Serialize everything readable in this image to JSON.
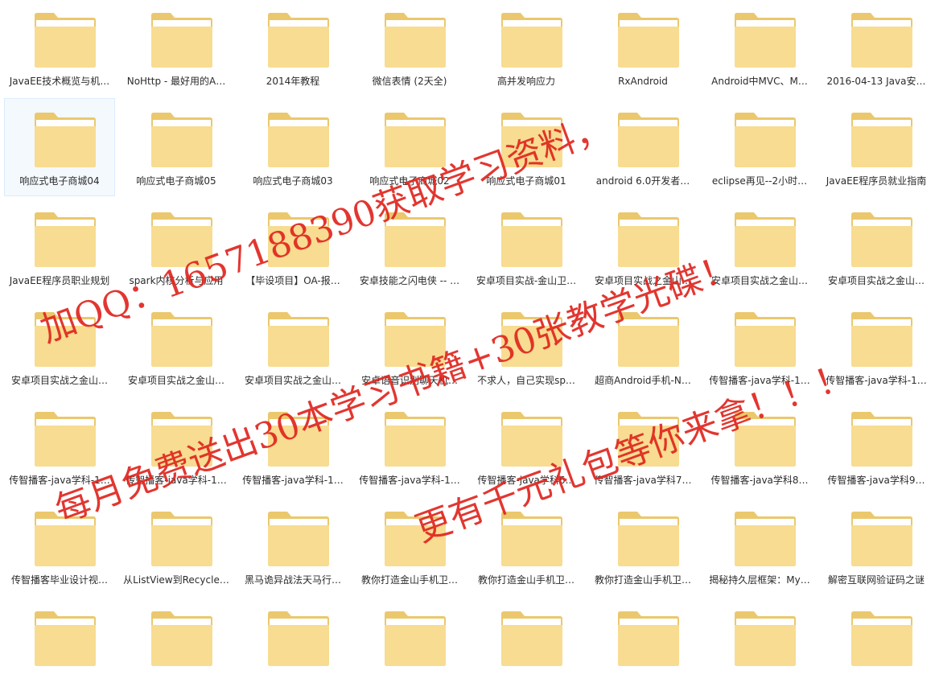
{
  "folders": [
    {
      "label": "JavaEE技术概览与机…",
      "selected": false
    },
    {
      "label": "NoHttp - 最好用的A…",
      "selected": false
    },
    {
      "label": "2014年教程",
      "selected": false
    },
    {
      "label": "微信表情 (2天全)",
      "selected": false
    },
    {
      "label": "高并发响应力",
      "selected": false
    },
    {
      "label": "RxAndroid",
      "selected": false
    },
    {
      "label": "Android中MVC、M…",
      "selected": false
    },
    {
      "label": "2016-04-13 Java安…",
      "selected": false
    },
    {
      "label": "响应式电子商城04",
      "selected": true
    },
    {
      "label": "响应式电子商城05",
      "selected": false
    },
    {
      "label": "响应式电子商城03",
      "selected": false
    },
    {
      "label": "响应式电子商城02",
      "selected": false
    },
    {
      "label": "响应式电子商城01",
      "selected": false
    },
    {
      "label": "android 6.0开发者…",
      "selected": false
    },
    {
      "label": "eclipse再见--2小时…",
      "selected": false
    },
    {
      "label": "JavaEE程序员就业指南",
      "selected": false
    },
    {
      "label": "JavaEE程序员职业规划",
      "selected": false
    },
    {
      "label": "spark内核分析与应用",
      "selected": false
    },
    {
      "label": "【毕设项目】OA-报…",
      "selected": false
    },
    {
      "label": "安卓技能之闪电侠 -- …",
      "selected": false
    },
    {
      "label": "安卓项目实战-金山卫…",
      "selected": false
    },
    {
      "label": "安卓项目实战之金山…",
      "selected": false
    },
    {
      "label": "安卓项目实战之金山…",
      "selected": false
    },
    {
      "label": "安卓项目实战之金山…",
      "selected": false
    },
    {
      "label": "安卓项目实战之金山…",
      "selected": false
    },
    {
      "label": "安卓项目实战之金山…",
      "selected": false
    },
    {
      "label": "安卓项目实战之金山…",
      "selected": false
    },
    {
      "label": "安卓语音识别聊天机…",
      "selected": false
    },
    {
      "label": "不求人，自己实现sp…",
      "selected": false
    },
    {
      "label": "超商Android手机-N…",
      "selected": false
    },
    {
      "label": "传智播客-java学科-1…",
      "selected": false
    },
    {
      "label": "传智播客-java学科-1…",
      "selected": false
    },
    {
      "label": "传智播客-java学科-1…",
      "selected": false
    },
    {
      "label": "传智播客-java学科-1…",
      "selected": false
    },
    {
      "label": "传智播客-java学科-1…",
      "selected": false
    },
    {
      "label": "传智播客-java学科-1…",
      "selected": false
    },
    {
      "label": "传智播客-java学科6…",
      "selected": false
    },
    {
      "label": "传智播客-java学科7…",
      "selected": false
    },
    {
      "label": "传智播客-java学科8…",
      "selected": false
    },
    {
      "label": "传智播客-java学科9…",
      "selected": false
    },
    {
      "label": "传智播客毕业设计视…",
      "selected": false
    },
    {
      "label": "从ListView到Recycle…",
      "selected": false
    },
    {
      "label": "黑马诡异战法天马行…",
      "selected": false
    },
    {
      "label": "教你打造金山手机卫…",
      "selected": false
    },
    {
      "label": "教你打造金山手机卫…",
      "selected": false
    },
    {
      "label": "教你打造金山手机卫…",
      "selected": false
    },
    {
      "label": "揭秘持久层框架：My…",
      "selected": false
    },
    {
      "label": "解密互联网验证码之谜",
      "selected": false
    },
    {
      "label": "",
      "selected": false
    },
    {
      "label": "",
      "selected": false
    },
    {
      "label": "",
      "selected": false
    },
    {
      "label": "",
      "selected": false
    },
    {
      "label": "",
      "selected": false
    },
    {
      "label": "",
      "selected": false
    },
    {
      "label": "",
      "selected": false
    },
    {
      "label": "",
      "selected": false
    }
  ],
  "folder_icon": "folder-icon",
  "colors": {
    "folder_back": "#ebc86d",
    "folder_front": "#f7dc91",
    "folder_paper": "#ffffff",
    "selection_bg": "#f4f9fe",
    "selection_border": "#dcecfc",
    "watermark": "#e0261f"
  },
  "watermark": {
    "line1": "加QQ：1657188390获取学习资料，",
    "line2": "每月免费送出30本学习书籍+30张教学光碟！",
    "line3": "更有千元礼包等你来拿！！！"
  }
}
